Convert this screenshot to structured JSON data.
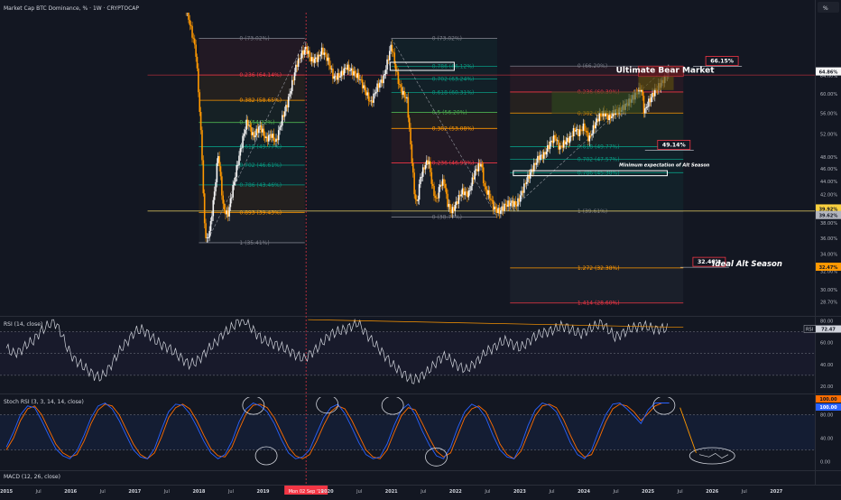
{
  "header": {
    "symbol_title": "Market Cap BTC Dominance, % · 1W · CRYPTOCAP",
    "scale_button": "%"
  },
  "colors": {
    "background": "#131722",
    "candle_up": "#f7f7f7",
    "candle_down": "#ff9800",
    "fib_red": "#f23645",
    "fib_orange": "#ff9800",
    "fib_green": "#4caf50",
    "fib_teal": "#089981",
    "fib_gray": "#787b86",
    "rsi_line": "#d1d4dc",
    "stoch_k": "#2962ff",
    "stoch_d": "#ff6d00",
    "annotation_white": "#ffffff",
    "trend_line_orange": "#ff9800",
    "guide_yellow": "#c9b458"
  },
  "chart_data": [
    {
      "type": "candlestick",
      "title": "Market Cap BTC Dominance, % · 1W · CRYPTOCAP",
      "ylabel": "%",
      "ylim": [
        27.5,
        80.0
      ],
      "y_scale": "log",
      "y_ticks": [
        "64.00%",
        "60.00%",
        "56.00%",
        "52.00%",
        "48.00%",
        "46.00%",
        "44.00%",
        "42.00%",
        "40.00%",
        "38.00%",
        "36.00%",
        "34.00%",
        "32.00%",
        "30.00%",
        "28.70%"
      ],
      "price_labels": {
        "last": "64.86%",
        "countdown": "1d 13h",
        "level_1": "39.92%",
        "level_2": "39.62%",
        "level_3": "32.47%"
      },
      "x_ticks": [
        "2015",
        "Jul",
        "2016",
        "Jul",
        "2017",
        "Jul",
        "2018",
        "Jul",
        "2019",
        "Jul",
        "Mon 02 Sep '19",
        "2020",
        "Jul",
        "2021",
        "Jul",
        "2022",
        "Jul",
        "2023",
        "Jul",
        "2024",
        "Jul",
        "2025",
        "Jul",
        "2026",
        "Jul",
        "2027"
      ],
      "x_tick_values": [
        2015.0,
        2015.5,
        2016.0,
        2016.5,
        2017.0,
        2017.5,
        2018.0,
        2018.5,
        2019.0,
        2019.5,
        2019.67,
        2020.0,
        2020.5,
        2021.0,
        2021.5,
        2022.0,
        2022.5,
        2023.0,
        2023.5,
        2024.0,
        2024.5,
        2025.0,
        2025.5,
        2026.0,
        2026.5,
        2027.0
      ],
      "crosshair_date_label": "Mon 02 Sep '19",
      "price_path": [
        [
          2017.3,
          95.5
        ],
        [
          2017.75,
          85
        ],
        [
          2017.95,
          70
        ],
        [
          2018.05,
          48
        ],
        [
          2018.08,
          38.5
        ],
        [
          2018.12,
          35.4
        ],
        [
          2018.18,
          37.5
        ],
        [
          2018.25,
          43
        ],
        [
          2018.3,
          48.5
        ],
        [
          2018.38,
          40
        ],
        [
          2018.45,
          39
        ],
        [
          2018.55,
          44
        ],
        [
          2018.7,
          52
        ],
        [
          2018.75,
          54.5
        ],
        [
          2018.85,
          51.5
        ],
        [
          2018.95,
          53.5
        ],
        [
          2019.05,
          51
        ],
        [
          2019.12,
          52
        ],
        [
          2019.2,
          50.5
        ],
        [
          2019.3,
          55
        ],
        [
          2019.38,
          58
        ],
        [
          2019.45,
          62
        ],
        [
          2019.52,
          66.5
        ],
        [
          2019.6,
          69
        ],
        [
          2019.67,
          70.5
        ],
        [
          2019.75,
          67.5
        ],
        [
          2019.85,
          68
        ],
        [
          2019.92,
          70
        ],
        [
          2020.0,
          68
        ],
        [
          2020.1,
          63.5
        ],
        [
          2020.2,
          64
        ],
        [
          2020.3,
          66
        ],
        [
          2020.42,
          64.5
        ],
        [
          2020.5,
          63.5
        ],
        [
          2020.58,
          61
        ],
        [
          2020.68,
          58
        ],
        [
          2020.78,
          61.5
        ],
        [
          2020.88,
          63.5
        ],
        [
          2020.95,
          68
        ],
        [
          2021.0,
          71.5
        ],
        [
          2021.06,
          66
        ],
        [
          2021.12,
          62
        ],
        [
          2021.18,
          60
        ],
        [
          2021.24,
          59
        ],
        [
          2021.3,
          50
        ],
        [
          2021.36,
          42
        ],
        [
          2021.4,
          40.5
        ],
        [
          2021.45,
          44.5
        ],
        [
          2021.52,
          46.5
        ],
        [
          2021.58,
          47.5
        ],
        [
          2021.64,
          43
        ],
        [
          2021.7,
          41
        ],
        [
          2021.76,
          43.5
        ],
        [
          2021.82,
          44
        ],
        [
          2021.88,
          40.5
        ],
        [
          2021.94,
          39.5
        ],
        [
          2022.0,
          40.5
        ],
        [
          2022.1,
          42.5
        ],
        [
          2022.2,
          42
        ],
        [
          2022.3,
          45.5
        ],
        [
          2022.4,
          47
        ],
        [
          2022.45,
          43
        ],
        [
          2022.52,
          42
        ],
        [
          2022.6,
          40
        ],
        [
          2022.68,
          39.5
        ],
        [
          2022.78,
          40.5
        ],
        [
          2022.88,
          40.8
        ],
        [
          2022.95,
          40.5
        ],
        [
          2023.0,
          41.5
        ],
        [
          2023.1,
          44
        ],
        [
          2023.2,
          46
        ],
        [
          2023.3,
          48
        ],
        [
          2023.38,
          48.3
        ],
        [
          2023.48,
          50.5
        ],
        [
          2023.55,
          51.5
        ],
        [
          2023.62,
          49.5
        ],
        [
          2023.7,
          50.5
        ],
        [
          2023.78,
          51.2
        ],
        [
          2023.86,
          53
        ],
        [
          2023.92,
          52.2
        ],
        [
          2024.0,
          53.5
        ],
        [
          2024.08,
          51
        ],
        [
          2024.16,
          53.5
        ],
        [
          2024.24,
          55.5
        ],
        [
          2024.32,
          56
        ],
        [
          2024.4,
          55
        ],
        [
          2024.48,
          56.5
        ],
        [
          2024.56,
          56.5
        ],
        [
          2024.64,
          57.5
        ],
        [
          2024.72,
          58.5
        ],
        [
          2024.78,
          59.5
        ],
        [
          2024.84,
          60.5
        ],
        [
          2024.9,
          61
        ],
        [
          2024.94,
          56
        ],
        [
          2024.98,
          57.5
        ],
        [
          2025.04,
          59
        ],
        [
          2025.1,
          60.5
        ],
        [
          2025.16,
          61.5
        ],
        [
          2025.22,
          62.5
        ],
        [
          2025.28,
          64.0
        ],
        [
          2025.33,
          64.86
        ]
      ],
      "fib_retracements": [
        {
          "levels": [
            {
              "label": "0 (73.02%)",
              "value": 73.02,
              "color": "#787b86"
            },
            {
              "label": "0.236 (64.14%)",
              "value": 64.14,
              "color": "#f23645"
            },
            {
              "label": "0.382 (58.65%)",
              "value": 58.65,
              "color": "#ff9800"
            },
            {
              "label": "0.5 (54.22%)",
              "value": 54.22,
              "color": "#4caf50"
            },
            {
              "label": "0.618 (49.77%)",
              "value": 49.77,
              "color": "#089981"
            },
            {
              "label": "0.702 (46.61%)",
              "value": 46.61,
              "color": "#089981"
            },
            {
              "label": "0.786 (43.46%)",
              "value": 43.46,
              "color": "#089981"
            },
            {
              "label": "0.893 (39.43%)",
              "value": 39.43,
              "color": "#ff9800"
            },
            {
              "label": "1 (35.41%)",
              "value": 35.41,
              "color": "#787b86"
            }
          ],
          "x_range": [
            2018.0,
            2019.65
          ]
        },
        {
          "levels": [
            {
              "label": "0 (73.02%)",
              "value": 73.02,
              "color": "#787b86"
            },
            {
              "label": "0.786 (66.12%)",
              "value": 66.12,
              "color": "#089981"
            },
            {
              "label": "0.702 (63.24%)",
              "value": 63.24,
              "color": "#089981"
            },
            {
              "label": "0.618 (60.31%)",
              "value": 60.31,
              "color": "#089981"
            },
            {
              "label": "0.5 (56.20%)",
              "value": 56.2,
              "color": "#4caf50"
            },
            {
              "label": "0.382 (53.08%)",
              "value": 53.08,
              "color": "#ff9800"
            },
            {
              "label": "0.236 (46.99%)",
              "value": 46.99,
              "color": "#f23645"
            },
            {
              "label": "0 (38.77%)",
              "value": 38.77,
              "color": "#787b86"
            }
          ],
          "x_range": [
            2021.0,
            2022.65
          ]
        },
        {
          "levels": [
            {
              "label": "0 (66.20%)",
              "value": 66.2,
              "color": "#787b86"
            },
            {
              "label": "0.236 (60.39%)",
              "value": 60.39,
              "color": "#f23645"
            },
            {
              "label": "0.382 (56.05%)",
              "value": 56.05,
              "color": "#ff9800"
            },
            {
              "label": "0.618 (49.77%)",
              "value": 49.77,
              "color": "#089981"
            },
            {
              "label": "0.702 (47.57%)",
              "value": 47.57,
              "color": "#089981"
            },
            {
              "label": "0.786 (45.38%)",
              "value": 45.38,
              "color": "#089981"
            },
            {
              "label": "1 (39.61%)",
              "value": 39.61,
              "color": "#787b86"
            },
            {
              "label": "1.272 (32.38%)",
              "value": 32.38,
              "color": "#ff9800"
            },
            {
              "label": "1.414 (28.60%)",
              "value": 28.6,
              "color": "#f23645"
            }
          ],
          "x_range": [
            2022.85,
            2025.55
          ]
        }
      ],
      "annotations": [
        {
          "text": "66.15%",
          "value": 66.15
        },
        {
          "text": "Ultimate Bear Market"
        },
        {
          "text": "49.14%",
          "value": 49.14
        },
        {
          "text": "Minimum expectation of Alt Season"
        },
        {
          "text": "32.46%",
          "value": 32.46
        },
        {
          "text": "Ideal Alt Season"
        }
      ]
    },
    {
      "type": "line",
      "title": "RSI (14, close)",
      "ylim": [
        15,
        82
      ],
      "y_ticks": [
        80,
        60,
        40,
        20
      ],
      "y_tick_labels": [
        "80.00",
        "60.00",
        "40.00",
        "20.00"
      ],
      "last_value_label": "RSI",
      "last_value": "72.47",
      "series": [
        {
          "values": [
            55,
            50,
            52,
            58,
            62,
            70,
            75,
            80,
            70,
            55,
            45,
            40,
            35,
            30,
            28,
            35,
            45,
            55,
            62,
            70,
            72,
            68,
            62,
            58,
            55,
            50,
            45,
            40,
            42,
            48,
            55,
            60,
            68,
            72,
            78,
            82,
            75,
            68,
            62,
            60,
            58,
            55,
            52,
            48,
            45,
            50,
            55,
            62,
            68,
            70,
            72,
            75,
            78,
            70,
            62,
            55,
            48,
            40,
            35,
            30,
            25,
            28,
            32,
            38,
            45,
            48,
            42,
            38,
            35,
            40,
            45,
            52,
            55,
            60,
            62,
            58,
            55,
            60,
            65,
            68,
            70,
            72,
            75,
            74,
            70,
            68,
            72,
            75,
            78,
            72,
            65,
            68,
            72,
            74,
            76,
            74,
            72,
            73,
            72.47
          ]
        }
      ]
    },
    {
      "type": "line",
      "title": "Stoch RSI (3, 3, 14, 14, close)",
      "ylim": [
        -10,
        110
      ],
      "y_ticks": [
        80,
        40,
        0
      ],
      "y_tick_labels": [
        "80.00",
        "40.00",
        "0.00"
      ],
      "last_values": [
        "100.00",
        "100.00"
      ],
      "series": [
        {
          "name": "D",
          "values": [
            20,
            40,
            70,
            90,
            95,
            80,
            55,
            30,
            15,
            8,
            12,
            35,
            65,
            88,
            98,
            95,
            80,
            55,
            30,
            12,
            5,
            15,
            42,
            75,
            92,
            98,
            90,
            70,
            45,
            22,
            10,
            8,
            25,
            55,
            82,
            96,
            98,
            92,
            75,
            50,
            25,
            10,
            5,
            12,
            35,
            62,
            85,
            95,
            90,
            70,
            45,
            20,
            8,
            5,
            20,
            50,
            78,
            92,
            88,
            65,
            40,
            18,
            8,
            15,
            45,
            75,
            90,
            95,
            85,
            60,
            30,
            12,
            5,
            18,
            48,
            78,
            95,
            98,
            92,
            72,
            45,
            20,
            8,
            12,
            38,
            68,
            90,
            98,
            95,
            85,
            70,
            82,
            95,
            100,
            100
          ]
        },
        {
          "name": "K",
          "values": [
            25,
            50,
            80,
            95,
            92,
            70,
            45,
            22,
            10,
            5,
            18,
            45,
            75,
            95,
            100,
            90,
            70,
            45,
            20,
            8,
            5,
            22,
            55,
            85,
            98,
            96,
            82,
            60,
            35,
            15,
            5,
            12,
            35,
            68,
            90,
            100,
            95,
            85,
            65,
            38,
            15,
            5,
            8,
            20,
            48,
            75,
            92,
            98,
            82,
            58,
            32,
            12,
            5,
            8,
            30,
            62,
            88,
            98,
            80,
            52,
            28,
            10,
            5,
            25,
            58,
            85,
            98,
            92,
            75,
            45,
            20,
            8,
            5,
            28,
            62,
            88,
            100,
            96,
            85,
            60,
            32,
            12,
            5,
            20,
            52,
            80,
            98,
            100,
            90,
            78,
            65,
            88,
            100,
            100,
            100
          ]
        }
      ]
    },
    {
      "type": "line",
      "title": "MACD (12, 26, close)",
      "series": []
    }
  ]
}
